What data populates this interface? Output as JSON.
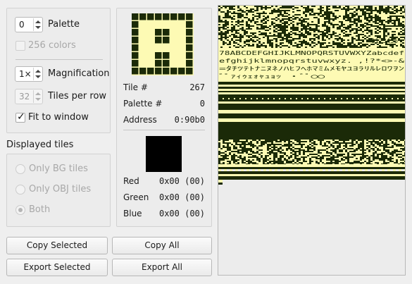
{
  "colors": {
    "gb_dark": "#1b2a08",
    "gb_light": "#fdfab4",
    "selected_color": "#000000"
  },
  "palette": {
    "value": "0",
    "label": "Palette"
  },
  "colors256": {
    "label": "256 colors",
    "checked": false,
    "enabled": false
  },
  "magnification": {
    "value": "1×",
    "label": "Magnification"
  },
  "tiles_per_row": {
    "value": "32",
    "label": "Tiles per row",
    "enabled": false
  },
  "fit_to_window": {
    "label": "Fit to window",
    "checked": true
  },
  "displayed_tiles": {
    "title": "Displayed tiles",
    "options": [
      "Only BG tiles",
      "Only OBJ tiles",
      "Both"
    ],
    "selected": "Both"
  },
  "tile_info": {
    "tile_label": "Tile #",
    "tile_value": "267",
    "palette_label": "Palette #",
    "palette_value": "0",
    "address_label": "Address",
    "address_value": "0:90b0"
  },
  "color_info": {
    "red_label": "Red",
    "red_value": "0x00 (00)",
    "green_label": "Green",
    "green_value": "0x00 (00)",
    "blue_label": "Blue",
    "blue_value": "0x00 (00)"
  },
  "buttons": {
    "copy_selected": "Copy Selected",
    "copy_all": "Copy All",
    "export_selected": "Export Selected",
    "export_all": "Export All"
  },
  "tile_text": {
    "line1": "78ABCDEFGHIJKLMNOPQRSTUVWXYZabcdef",
    "line2": "efghijklmnopqrstuvwxyz. ,!?*<>-&",
    "line3": "=ﾀﾁﾂﾃﾄﾅﾆﾇﾈﾉﾊﾋﾌﾍﾎﾏﾐﾑﾒﾓﾔﾕﾖﾗﾘﾙﾚﾛﾜｦﾝ",
    "line4": "ﾞﾟｧｨｩｪｫｬｭｮｯ ·ﾞﾟ◯◯",
    "digits": "0123456"
  }
}
